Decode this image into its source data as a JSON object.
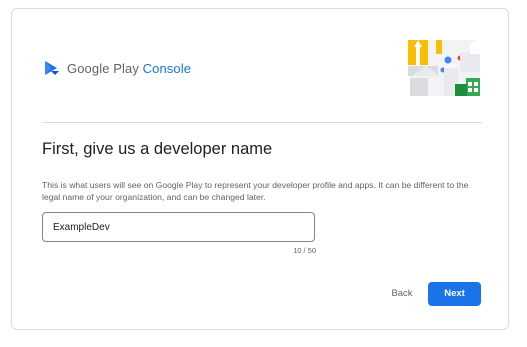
{
  "brand": {
    "google_play": "Google Play",
    "console": "Console",
    "logo_icon": "google-play-console-logo",
    "accent_color": "#1a73e8"
  },
  "page": {
    "title": "First, give us a developer name",
    "description": "This is what users will see on Google Play to represent your developer profile and apps. It can be different to the legal name of your organization, and can be changed later."
  },
  "developer_name": {
    "value": "ExampleDev",
    "counter": "10 / 50"
  },
  "actions": {
    "back_label": "Back",
    "next_label": "Next"
  }
}
